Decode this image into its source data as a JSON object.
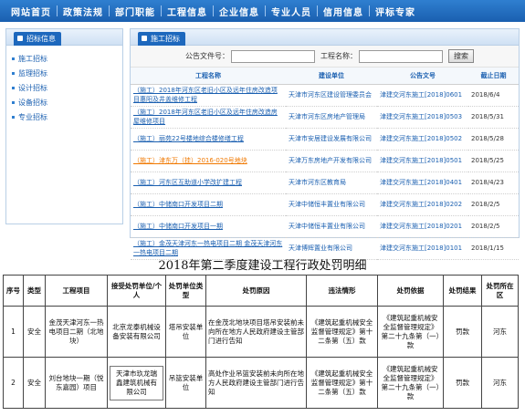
{
  "nav": {
    "items": [
      "网站首页",
      "政策法规",
      "部门职能",
      "工程信息",
      "企业信息",
      "专业人员",
      "信用信息",
      "评标专家"
    ]
  },
  "sidebar": {
    "tab_label": "招标信息",
    "items": [
      "施工招标",
      "监理招标",
      "设计招标",
      "设备招标",
      "专业招标"
    ]
  },
  "main": {
    "tab_label": "施工招标",
    "search": {
      "doc_no_label": "公告文件号：",
      "project_label": "工程名称：",
      "button": "搜索"
    },
    "headers": [
      "工程名称",
      "建设单位",
      "公告文号",
      "截止日期"
    ],
    "rows": [
      {
        "title": "（施工）2018年河东区老旧小区及远年住房改造项目惠阳及井盖维修工程",
        "owner": "天津市河东区建设管理委员会",
        "doc": "津建交河东施工[2018]0601",
        "date": "2018/6/4"
      },
      {
        "title": "（施工）2018年河东区老旧小区及远年住房改造房屋维修项目",
        "owner": "天津市河东区房地产管理局",
        "doc": "津建交河东施工[2018]0503",
        "date": "2018/5/31"
      },
      {
        "title": "（施工）丽苑22号楼地综合楼修缮工程",
        "owner": "天津市安居建设发展有限公司",
        "doc": "津建交河东施工[2018]0502",
        "date": "2018/5/28"
      },
      {
        "title": "（施工）津东万（挂）2016-020号地块",
        "owner": "天津万东房地产开发有限公司",
        "doc": "津建交河东施工[2018]0501",
        "date": "2018/5/25"
      },
      {
        "title": "（施工）河东区互助道小学改扩建工程",
        "owner": "天津市河东区教育局",
        "doc": "津建交河东施工[2018]0401",
        "date": "2018/4/23"
      },
      {
        "title": "（施工）中储南口开发项目二期",
        "owner": "天津中储恒丰置业有限公司",
        "doc": "津建交河东施工[2018]0202",
        "date": "2018/2/5"
      },
      {
        "title": "（施工）中储南口开发项目一期",
        "owner": "天津中储恒丰置业有限公司",
        "doc": "津建交河东施工[2018]0201",
        "date": "2018/2/5"
      },
      {
        "title": "（施工）金茂天津河东一热电项目二期 金茂天津河东一热电项目二期",
        "owner": "天津博辉置业有限公司",
        "doc": "津建交河东施工[2018]0101",
        "date": "2018/1/15"
      }
    ]
  },
  "penalty": {
    "title": "2018年第二季度建设工程行政处罚明细",
    "headers": [
      "序号",
      "类型",
      "工程项目",
      "接受处罚单位/个人",
      "处罚单位类型",
      "处罚原因",
      "违法情形",
      "处罚依据",
      "处罚结果",
      "处罚所在区"
    ],
    "rows": [
      [
        "1",
        "安全",
        "金茂天津河东一热电项目二期（北地块）",
        "北京龙泰机械设备安装有限公司",
        "塔吊安装单位",
        "在金茂北地块项目塔吊安装前未向所在地方人民政府建设主管部门进行告知",
        "《建筑起重机械安全监督管理规定》第十二条第（五）款",
        "《建筑起重机械安全监督管理规定》第二十九条第（一）款",
        "罚款",
        "河东"
      ],
      [
        "2",
        "安全",
        "刘台地块一期（悦东嘉园）项目",
        "天津市玖龙瑞鑫建筑机械有限公司",
        "吊篮安装单位",
        "高处作业吊篮安装前未向所在地方人民政府建设主管部门进行告知",
        "《建筑起重机械安全监督管理规定》第十二条第（五）款",
        "《建筑起重机械安全监督管理规定》第二十九条第（一）款",
        "罚款",
        "河东"
      ]
    ]
  }
}
